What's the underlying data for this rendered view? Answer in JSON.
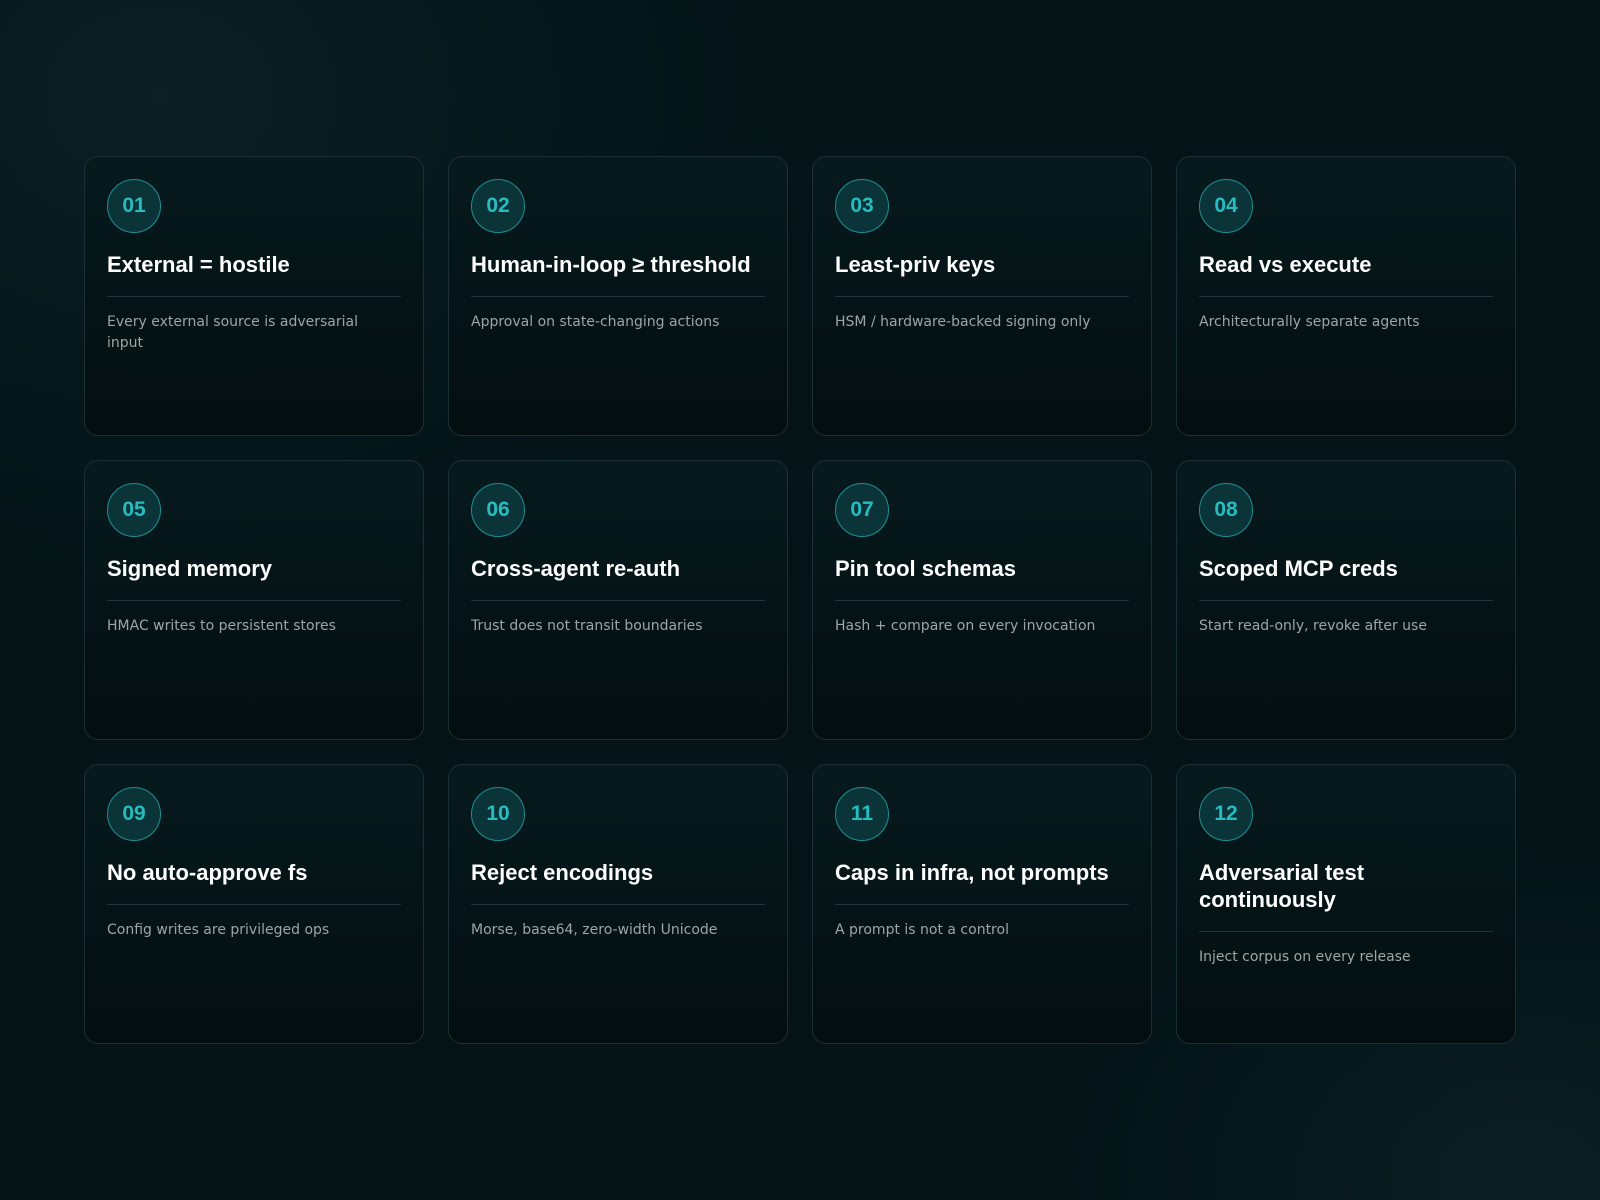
{
  "cards": [
    {
      "number": "01",
      "title": "External = hostile",
      "description": "Every external source is adversarial input"
    },
    {
      "number": "02",
      "title": "Human-in-loop ≥ threshold",
      "description": "Approval on state-changing actions"
    },
    {
      "number": "03",
      "title": "Least-priv keys",
      "description": "HSM / hardware-backed signing only"
    },
    {
      "number": "04",
      "title": "Read vs execute",
      "description": "Architecturally separate agents"
    },
    {
      "number": "05",
      "title": "Signed memory",
      "description": "HMAC writes to persistent stores"
    },
    {
      "number": "06",
      "title": "Cross-agent re-auth",
      "description": "Trust does not transit boundaries"
    },
    {
      "number": "07",
      "title": "Pin tool schemas",
      "description": "Hash + compare on every invocation"
    },
    {
      "number": "08",
      "title": "Scoped MCP creds",
      "description": "Start read-only, revoke after use"
    },
    {
      "number": "09",
      "title": "No auto-approve fs",
      "description": "Config writes are privileged ops"
    },
    {
      "number": "10",
      "title": "Reject encodings",
      "description": "Morse, base64, zero-width Unicode"
    },
    {
      "number": "11",
      "title": "Caps in infra, not prompts",
      "description": "A prompt is not a control"
    },
    {
      "number": "12",
      "title": "Adversarial test continuously",
      "description": "Inject corpus on every release"
    }
  ],
  "colors": {
    "accent": "#27bcc0",
    "badge_bg": "#0b3438",
    "page_bg": "#031316",
    "title": "#ffffff",
    "description": "#9aa6a8"
  }
}
